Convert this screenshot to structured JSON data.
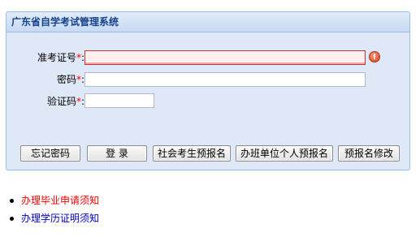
{
  "panel": {
    "title": "广东省自学考试管理系统"
  },
  "form": {
    "admission_label": "准考证号",
    "password_label": "密码",
    "captcha_label": "验证码",
    "required_mark": "*",
    "colon": ":",
    "admission_value": "",
    "password_value": "",
    "captcha_value": ""
  },
  "buttons": {
    "forgot_password": "忘记密码",
    "login": "登 录",
    "social_prereg": "社会考生预报名",
    "org_prereg": "办班单位个人预报名",
    "modify_prereg": "预报名修改"
  },
  "links": [
    {
      "label": "办理毕业申请须知",
      "color": "#ff0000"
    },
    {
      "label": "办理学历证明须知",
      "color": "#0000cc"
    }
  ],
  "colors": {
    "panel_bg": "#dfe8f6",
    "panel_border": "#99bbe8",
    "header_text": "#15428b",
    "required": "#ff0000",
    "error_border": "#cc3333"
  }
}
